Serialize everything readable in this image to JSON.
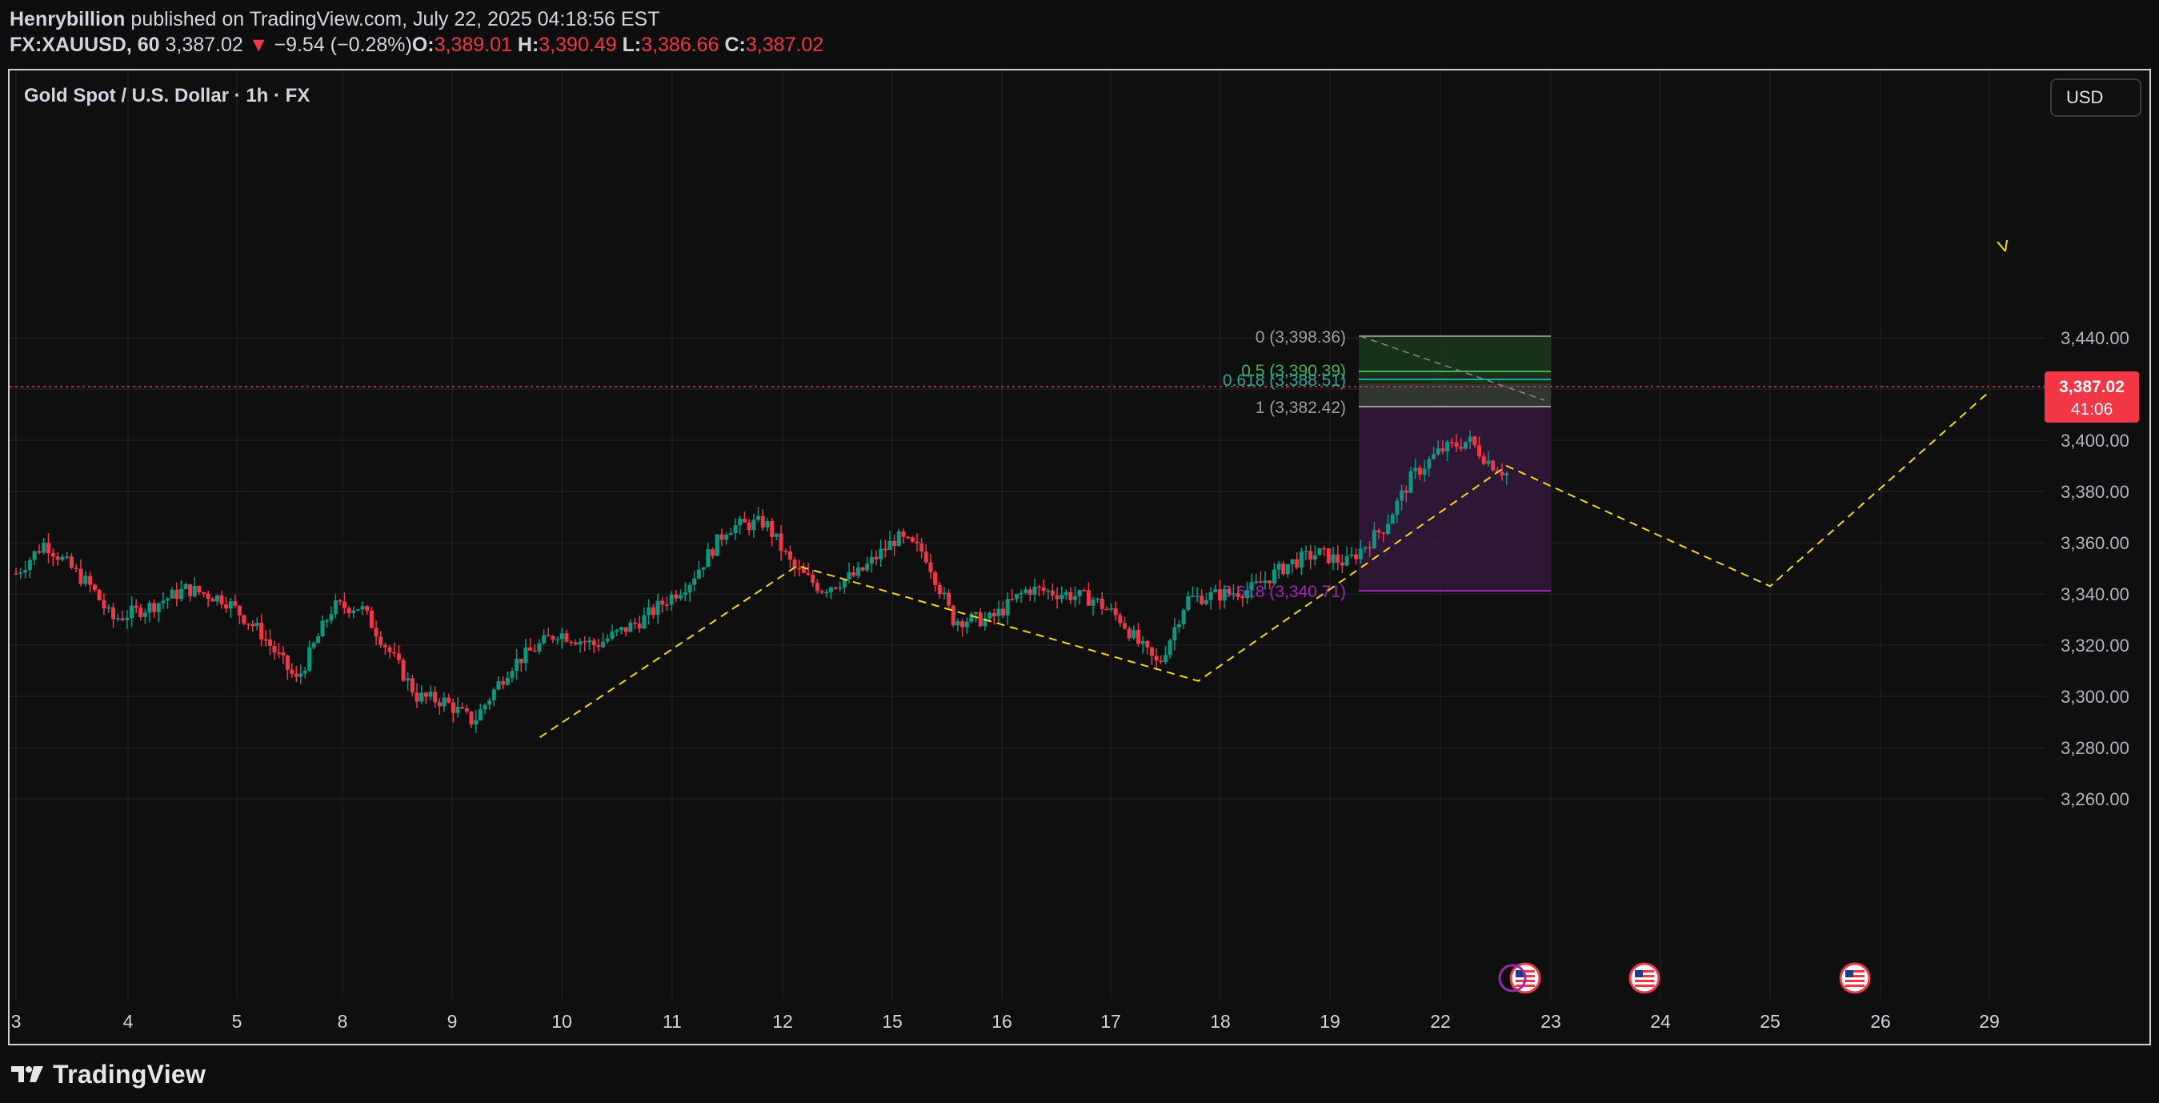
{
  "header": {
    "author": "Henrybillion",
    "published_text": "published on TradingView.com, July 22, 2025 04:18:56 EST"
  },
  "quote": {
    "symbol": "FX:XAUUSD, 60",
    "last": "3,387.02",
    "arrow": "▼",
    "change": "−9.54 (−0.28%)",
    "open_label": "O:",
    "open": "3,389.01",
    "high_label": "H:",
    "high": "3,390.49",
    "low_label": "L:",
    "low": "3,386.66",
    "close_label": "C:",
    "close": "3,387.02"
  },
  "chart_title": "Gold Spot / U.S. Dollar · 1h · FX",
  "currency_button": "USD",
  "price_tag": {
    "price": "3,387.02",
    "countdown": "41:06"
  },
  "fib_labels": {
    "level_0": "0 (3,398.36)",
    "level_05": "0.5 (3,390.39)",
    "level_0618": "0.618 (3,388.51)",
    "level_1": "1 (3,382.42)",
    "level_3618": "3.618 (3,340.71)"
  },
  "footer": {
    "brand": "TradingView"
  },
  "colors": {
    "up": "#089981",
    "down": "#f23645",
    "dashed_path": "#f5d90a",
    "fib_purple": "#9c27b0",
    "background": "#0f0f0f"
  },
  "chart_data": {
    "type": "candlestick",
    "title": "Gold Spot / U.S. Dollar · 1h · FX",
    "y_ticks": [
      "3,440.00",
      "3,420.00",
      "3,400.00",
      "3,380.00",
      "3,360.00",
      "3,340.00",
      "3,320.00",
      "3,300.00",
      "3,280.00",
      "3,260.00"
    ],
    "x_ticks": [
      "3",
      "4",
      "5",
      "8",
      "9",
      "10",
      "11",
      "12",
      "15",
      "16",
      "17",
      "18",
      "19",
      "22",
      "23",
      "24",
      "25",
      "26",
      "29"
    ],
    "ylim": [
      3250,
      3450
    ],
    "last_price": 3387.02,
    "fib_levels": [
      3398.36,
      3390.39,
      3388.51,
      3382.42,
      3340.71
    ],
    "projection_path": [
      [
        9.8,
        3284
      ],
      [
        12.4,
        3351
      ],
      [
        17.8,
        3306
      ],
      [
        22.6,
        3390
      ],
      [
        25.0,
        3343
      ],
      [
        29.0,
        3419
      ]
    ],
    "event_markers": [
      "us-flag",
      "us-flag",
      "us-flag",
      "us-flag"
    ],
    "grid": true
  }
}
